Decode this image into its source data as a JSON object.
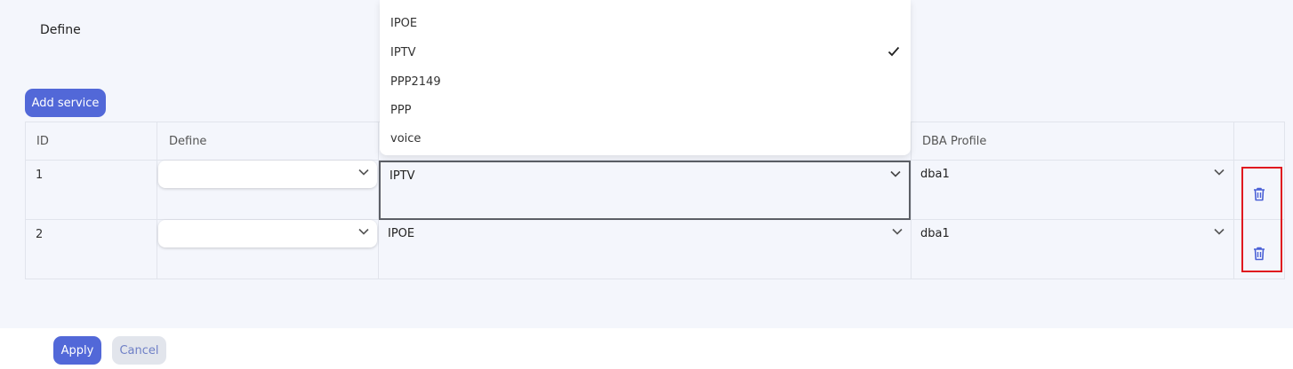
{
  "section": {
    "title": "Define"
  },
  "toolbar": {
    "add_label": "Add service"
  },
  "table": {
    "headers": {
      "id": "ID",
      "define": "Define",
      "service": "",
      "dba": "DBA Profile"
    },
    "rows": [
      {
        "id": "1",
        "define": "",
        "service": "IPTV",
        "dba": "dba1"
      },
      {
        "id": "2",
        "define": "",
        "service": "IPOE",
        "dba": "dba1"
      }
    ]
  },
  "dropdown": {
    "options": [
      "IPOE",
      "IPTV",
      "PPP2149",
      "PPP",
      "voice"
    ],
    "selected": "IPTV"
  },
  "footer": {
    "apply_label": "Apply",
    "cancel_label": "Cancel"
  },
  "colors": {
    "primary": "#5268d8",
    "panel_bg": "#f4f6fc",
    "highlight_border": "#e0191f"
  },
  "icons": {
    "select": "chevron-down-icon",
    "delete": "trash-icon",
    "selected_option": "check-icon"
  }
}
